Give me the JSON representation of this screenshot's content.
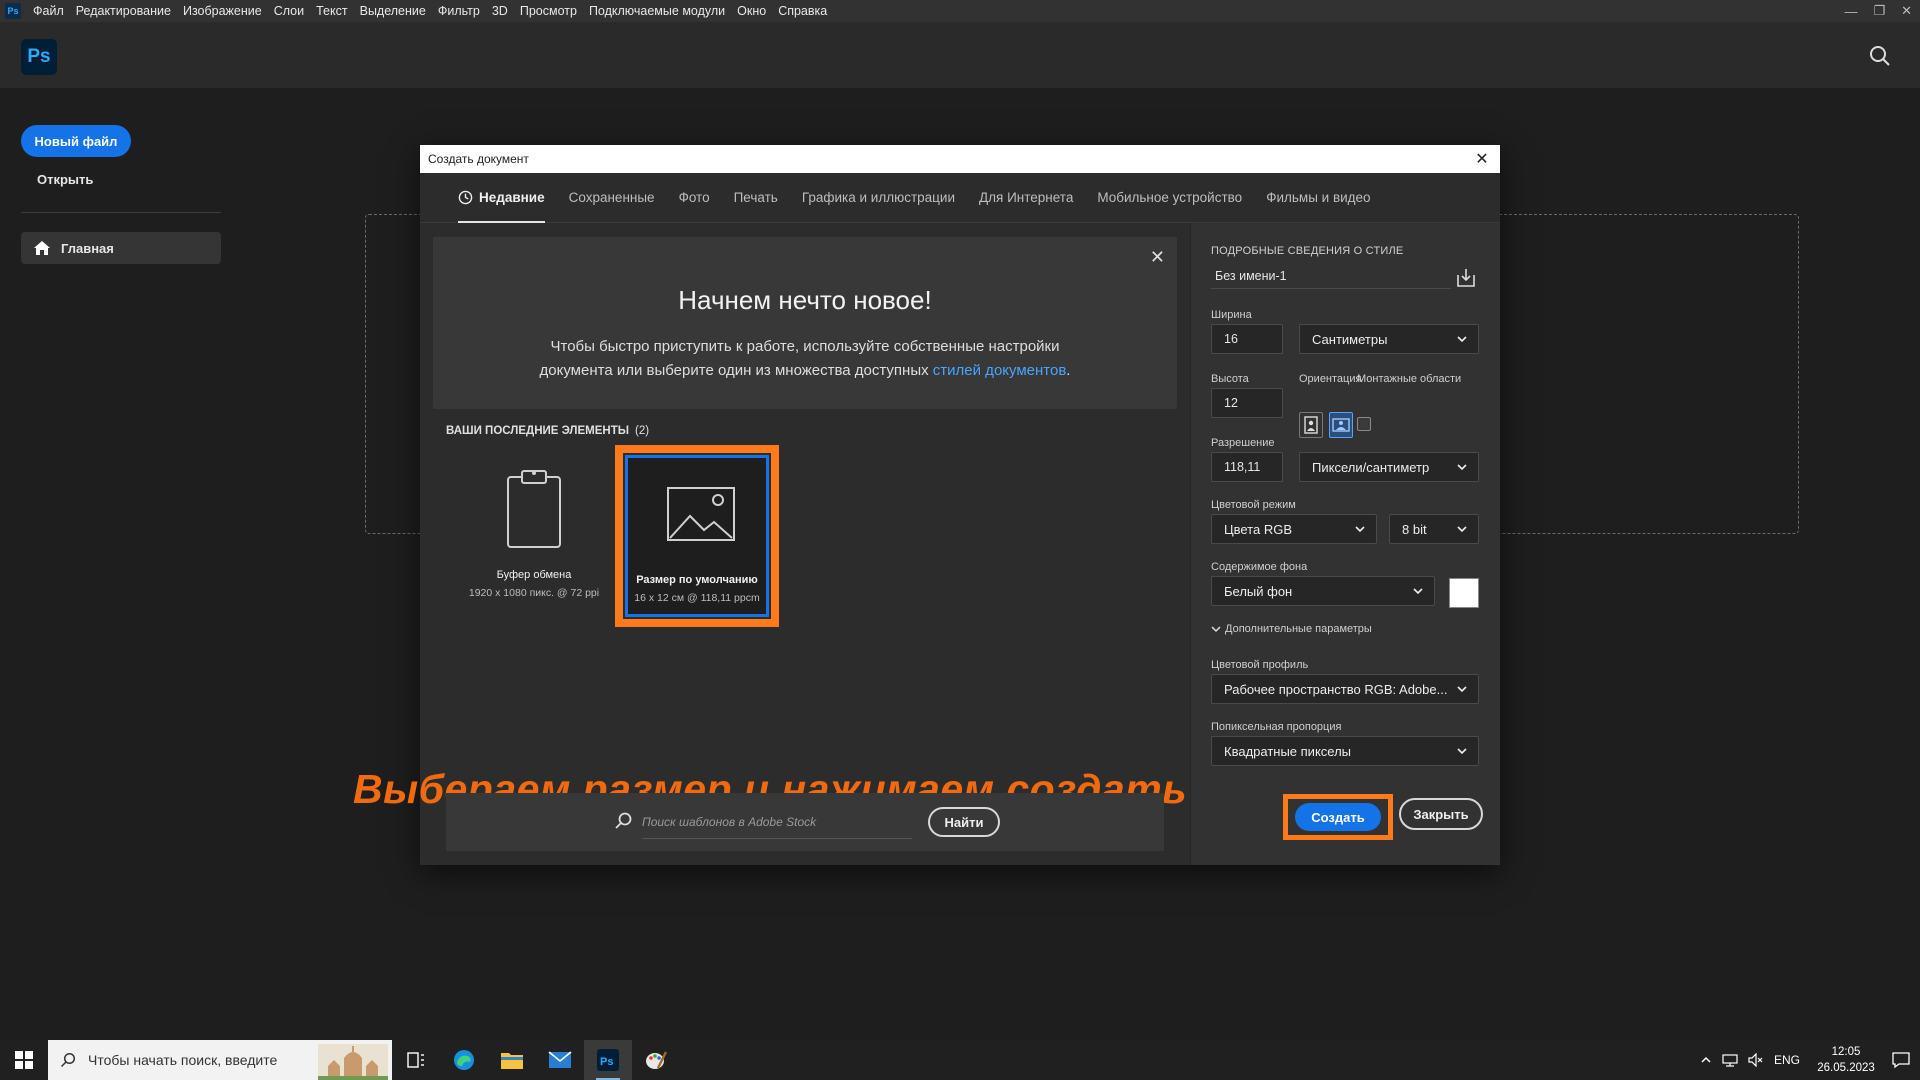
{
  "menubar": {
    "app_icon": "ps-mini-icon",
    "app_icon_text": "Ps",
    "items": [
      "Файл",
      "Редактирование",
      "Изображение",
      "Слои",
      "Текст",
      "Выделение",
      "Фильтр",
      "3D",
      "Просмотр",
      "Подключаемые модули",
      "Окно",
      "Справка"
    ]
  },
  "header": {
    "logo": "Ps"
  },
  "home": {
    "new_file": "Новый файл",
    "open": "Открыть",
    "home_item": "Главная"
  },
  "dialog": {
    "title": "Создать документ",
    "tabs": [
      "Недавние",
      "Сохраненные",
      "Фото",
      "Печать",
      "Графика и иллюстрации",
      "Для Интернета",
      "Мобильное устройство",
      "Фильмы и видео"
    ],
    "active_tab": "Недавние",
    "welcome": {
      "title": "Начнем нечто новое!",
      "text": "Чтобы быстро приступить к работе, используйте собственные настройки документа или выберите один из множества доступных",
      "link": "стилей документов",
      "text_end": "."
    },
    "recent": {
      "title": "ВАШИ ПОСЛЕДНИЕ ЭЛЕМЕНТЫ",
      "count": "(2)",
      "items": [
        {
          "name": "Буфер обмена",
          "desc": "1920 x 1080 пикс. @ 72 ppi"
        },
        {
          "name": "Размер по умолчанию",
          "desc": "16 x 12 см @ 118,11 ppcm"
        }
      ]
    },
    "annotation": "Выбераем размер и нажимаем создать",
    "search": {
      "placeholder": "Поиск шаблонов в Adobe Stock",
      "button": "Найти"
    },
    "details": {
      "heading": "ПОДРОБНЫЕ СВЕДЕНИЯ О СТИЛЕ",
      "doc_name": "Без имени-1",
      "width_label": "Ширина",
      "width_value": "16",
      "width_unit": "Сантиметры",
      "height_label": "Высота",
      "height_value": "12",
      "orientation_label": "Ориентация",
      "artboards_label": "Монтажные области",
      "resolution_label": "Разрешение",
      "resolution_value": "118,11",
      "resolution_unit": "Пиксели/сантиметр",
      "color_mode_label": "Цветовой режим",
      "color_mode": "Цвета RGB",
      "bit_depth": "8 bit",
      "background_label": "Содержимое фона",
      "background": "Белый фон",
      "background_color": "#ffffff",
      "advanced": "Дополнительные параметры",
      "profile_label": "Цветовой профиль",
      "profile": "Рабочее пространство RGB: Adobe...",
      "pixel_aspect_label": "Попиксельная пропорция",
      "pixel_aspect": "Квадратные пикселы",
      "create": "Создать",
      "close": "Закрыть"
    }
  },
  "taskbar": {
    "search_placeholder": "Чтобы начать поиск, введите",
    "apps": [
      "task-view-icon",
      "edge-icon",
      "file-explorer-icon",
      "mail-icon",
      "photoshop-icon",
      "paint-icon"
    ],
    "lang": "ENG",
    "time": "12:05",
    "date": "26.05.2023"
  },
  "colors": {
    "accent": "#1473e6",
    "highlight": "#ff7a1a",
    "annotation": "#f26a10"
  }
}
